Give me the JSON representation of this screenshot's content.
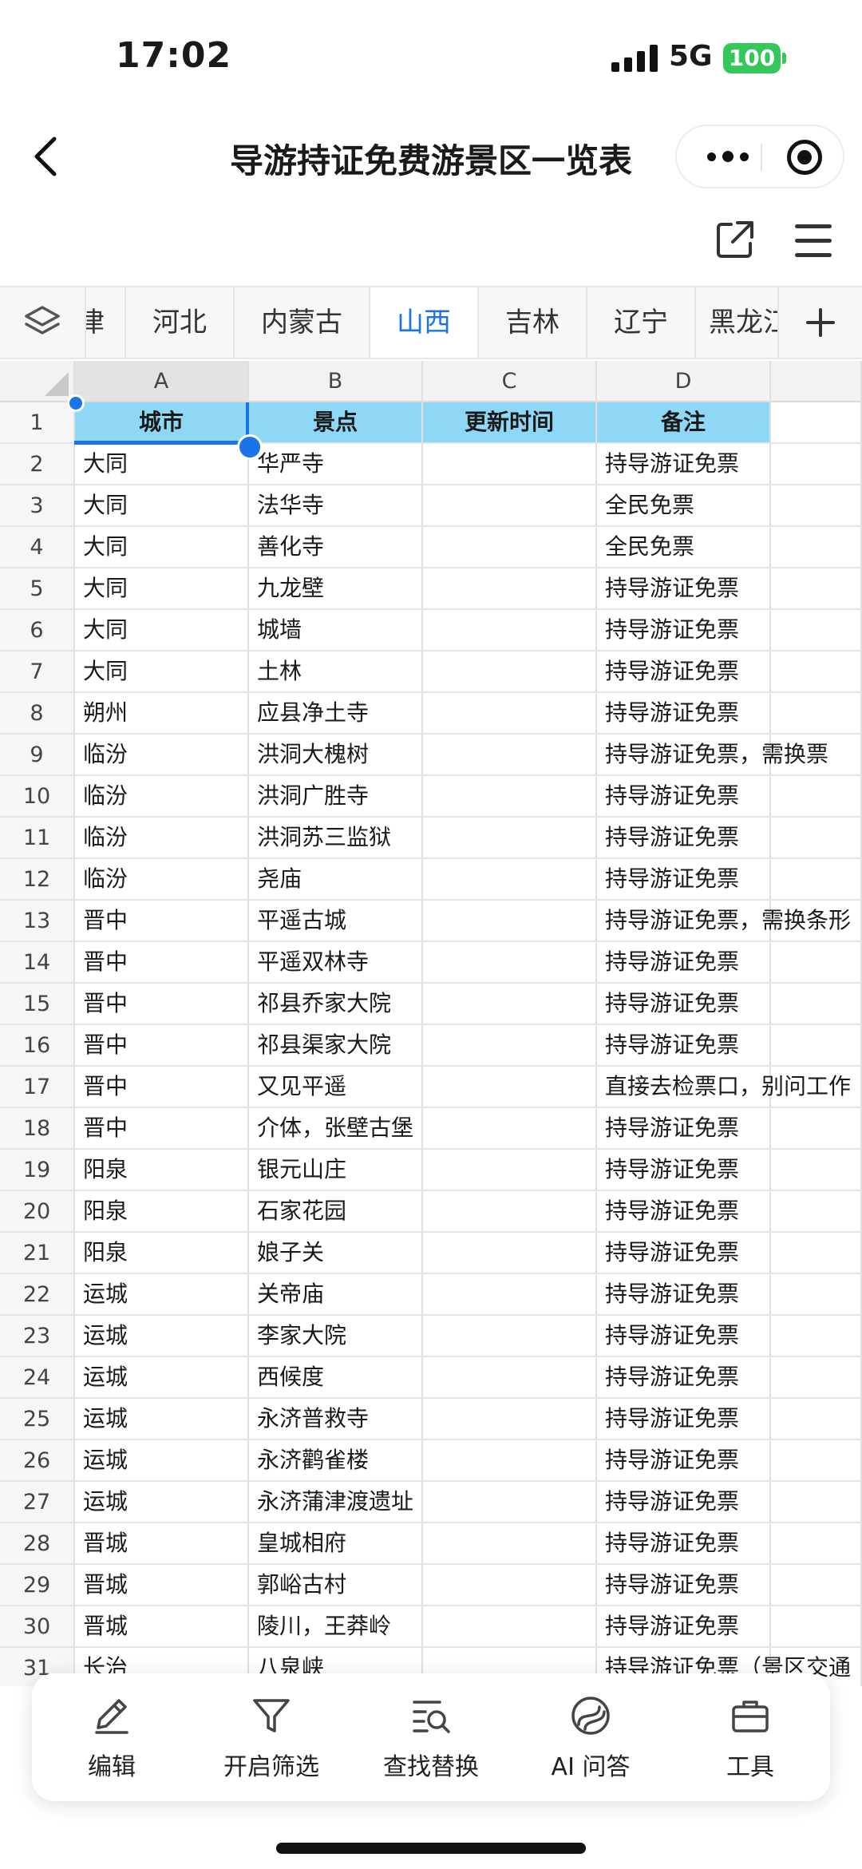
{
  "status": {
    "time": "17:02",
    "network": "5G",
    "battery": "100"
  },
  "nav": {
    "title": "导游持证免费游景区一览表"
  },
  "sheet_tabs": [
    {
      "label": "天津",
      "active": false
    },
    {
      "label": "河北",
      "active": false
    },
    {
      "label": "内蒙古",
      "active": false
    },
    {
      "label": "山西",
      "active": true
    },
    {
      "label": "吉林",
      "active": false
    },
    {
      "label": "辽宁",
      "active": false
    },
    {
      "label": "黑龙江",
      "active": false
    }
  ],
  "columns": [
    "A",
    "B",
    "C",
    "D"
  ],
  "header_row": {
    "num": "1",
    "cells": [
      "城市",
      "景点",
      "更新时间",
      "备注"
    ]
  },
  "rows": [
    {
      "num": "2",
      "city": "大同",
      "spot": "华严寺",
      "time": "",
      "note": "持导游证免票"
    },
    {
      "num": "3",
      "city": "大同",
      "spot": "法华寺",
      "time": "",
      "note": "全民免票"
    },
    {
      "num": "4",
      "city": "大同",
      "spot": "善化寺",
      "time": "",
      "note": "全民免票"
    },
    {
      "num": "5",
      "city": "大同",
      "spot": "九龙壁",
      "time": "",
      "note": "持导游证免票"
    },
    {
      "num": "6",
      "city": "大同",
      "spot": "城墙",
      "time": "",
      "note": "持导游证免票"
    },
    {
      "num": "7",
      "city": "大同",
      "spot": "土林",
      "time": "",
      "note": "持导游证免票"
    },
    {
      "num": "8",
      "city": "朔州",
      "spot": "应县净土寺",
      "time": "",
      "note": "持导游证免票"
    },
    {
      "num": "9",
      "city": "临汾",
      "spot": "洪洞大槐树",
      "time": "",
      "note": "持导游证免票，需换票"
    },
    {
      "num": "10",
      "city": "临汾",
      "spot": "洪洞广胜寺",
      "time": "",
      "note": "持导游证免票"
    },
    {
      "num": "11",
      "city": "临汾",
      "spot": "洪洞苏三监狱",
      "time": "",
      "note": "持导游证免票"
    },
    {
      "num": "12",
      "city": "临汾",
      "spot": "尧庙",
      "time": "",
      "note": "持导游证免票"
    },
    {
      "num": "13",
      "city": "晋中",
      "spot": "平遥古城",
      "time": "",
      "note": "持导游证免票，需换条形"
    },
    {
      "num": "14",
      "city": "晋中",
      "spot": "平遥双林寺",
      "time": "",
      "note": "持导游证免票"
    },
    {
      "num": "15",
      "city": "晋中",
      "spot": "祁县乔家大院",
      "time": "",
      "note": "持导游证免票"
    },
    {
      "num": "16",
      "city": "晋中",
      "spot": "祁县渠家大院",
      "time": "",
      "note": "持导游证免票"
    },
    {
      "num": "17",
      "city": "晋中",
      "spot": "又见平遥",
      "time": "",
      "note": "直接去检票口，别问工作"
    },
    {
      "num": "18",
      "city": "晋中",
      "spot": "介体，张壁古堡",
      "time": "",
      "note": "持导游证免票"
    },
    {
      "num": "19",
      "city": "阳泉",
      "spot": "银元山庄",
      "time": "",
      "note": "持导游证免票"
    },
    {
      "num": "20",
      "city": "阳泉",
      "spot": "石家花园",
      "time": "",
      "note": "持导游证免票"
    },
    {
      "num": "21",
      "city": "阳泉",
      "spot": "娘子关",
      "time": "",
      "note": "持导游证免票"
    },
    {
      "num": "22",
      "city": "运城",
      "spot": "关帝庙",
      "time": "",
      "note": "持导游证免票"
    },
    {
      "num": "23",
      "city": "运城",
      "spot": "李家大院",
      "time": "",
      "note": "持导游证免票"
    },
    {
      "num": "24",
      "city": "运城",
      "spot": "西候度",
      "time": "",
      "note": "持导游证免票"
    },
    {
      "num": "25",
      "city": "运城",
      "spot": "永济普救寺",
      "time": "",
      "note": "持导游证免票"
    },
    {
      "num": "26",
      "city": "运城",
      "spot": "永济鹳雀楼",
      "time": "",
      "note": "持导游证免票"
    },
    {
      "num": "27",
      "city": "运城",
      "spot": "永济蒲津渡遗址",
      "time": "",
      "note": "持导游证免票"
    },
    {
      "num": "28",
      "city": "晋城",
      "spot": "皇城相府",
      "time": "",
      "note": "持导游证免票"
    },
    {
      "num": "29",
      "city": "晋城",
      "spot": "郭峪古村",
      "time": "",
      "note": "持导游证免票"
    },
    {
      "num": "30",
      "city": "晋城",
      "spot": "陵川，王莽岭",
      "time": "",
      "note": "持导游证免票"
    },
    {
      "num": "31",
      "city": "长治",
      "spot": "八泉峡",
      "time": "",
      "note": "持导游证免票（景区交通"
    }
  ],
  "toolbar": {
    "edit": "编辑",
    "filter": "开启筛选",
    "find_replace": "查找替换",
    "ai": "AI 问答",
    "tools": "工具"
  }
}
